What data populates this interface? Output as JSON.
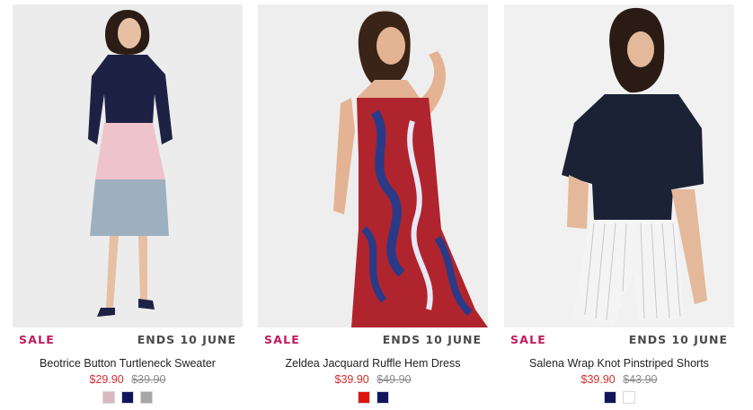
{
  "products": [
    {
      "badge": "SALE",
      "promo": "ENDS 10 JUNE",
      "name": "Beotrice Button Turtleneck Sweater",
      "price_now": "$29.90",
      "price_was": "$39.90",
      "swatches": [
        "#d9b8bf",
        "#12155e",
        "#a6a6a6"
      ]
    },
    {
      "badge": "SALE",
      "promo": "ENDS 10 JUNE",
      "name": "Zeldea Jacquard Ruffle Hem Dress",
      "price_now": "$39.90",
      "price_was": "$49.90",
      "swatches": [
        "#e0140f",
        "#12155e"
      ]
    },
    {
      "badge": "SALE",
      "promo": "ENDS 10 JUNE",
      "name": "Salena Wrap Knot Pinstriped Shorts",
      "price_now": "$39.90",
      "price_was": "$43.90",
      "swatches": [
        "#12155e",
        "#ffffff"
      ]
    }
  ]
}
